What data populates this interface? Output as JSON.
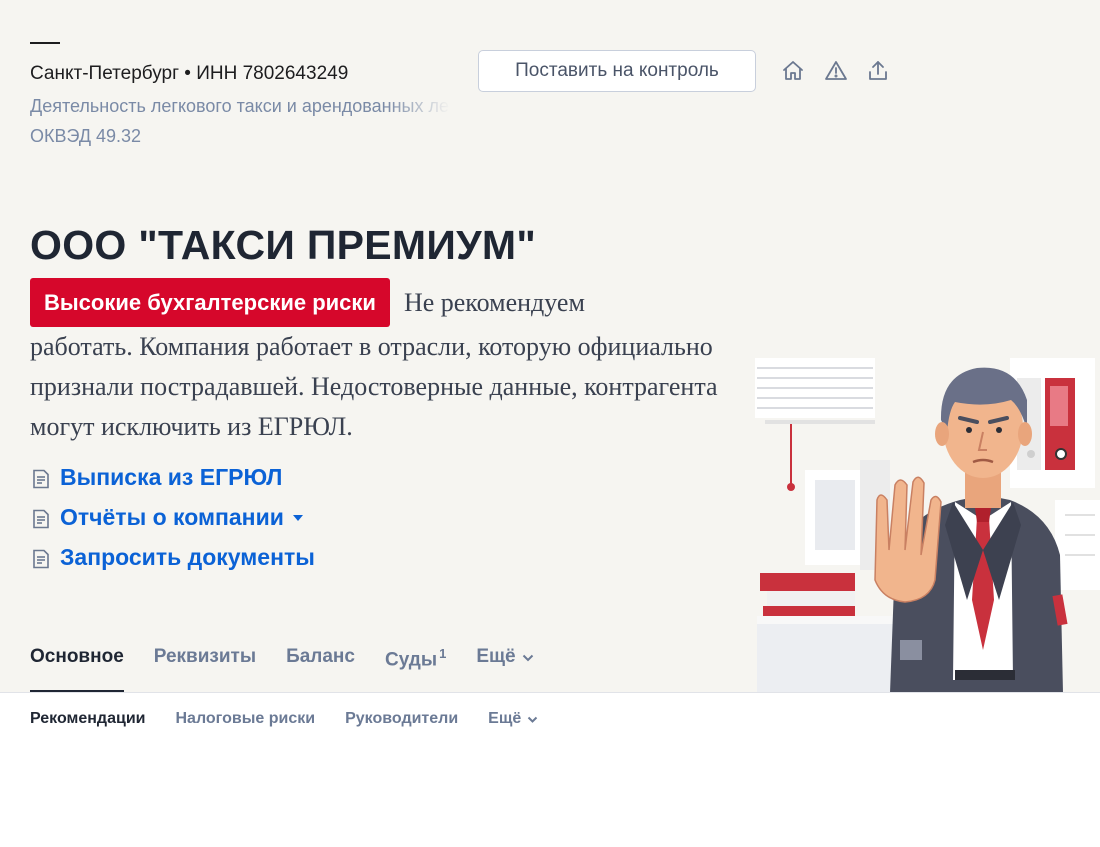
{
  "header": {
    "location": "Санкт-Петербург • ИНН 7802643249",
    "activity": "Деятельность легкового такси и арендованных легковых автомобилей с водителем",
    "okved": "ОКВЭД 49.32",
    "control_button": "Поставить на контроль",
    "icons": [
      "home-icon",
      "warning-icon",
      "share-icon"
    ]
  },
  "company": {
    "name": "ООО \"ТАКСИ ПРЕМИУМ\""
  },
  "risk": {
    "badge": "Высокие бухгалтерские риски",
    "line1": "Не рекомендуем",
    "rest": "работать. Компания работает в отрасли, которую официально признали пострадавшей. Недостоверные данные, контрагента могут исключить из ЕГРЮЛ.",
    "badge_color": "#d6072b"
  },
  "links": [
    {
      "label": "Выписка из ЕГРЮЛ"
    },
    {
      "label": "Отчёты о компании"
    },
    {
      "label": "Запросить документы"
    }
  ],
  "tabs": {
    "main": "Основное",
    "requisites": "Реквизиты",
    "balance": "Баланс",
    "courts": "Суды",
    "courts_count": "1",
    "more": "Ещё"
  },
  "subtabs": {
    "recommendations": "Рекомендации",
    "tax_risks": "Налоговые риски",
    "managers": "Руководители",
    "more": "Ещё"
  },
  "colors": {
    "link": "#0b62d6",
    "hero_bg": "#f6f5f1",
    "accent_red": "#d6072b"
  }
}
